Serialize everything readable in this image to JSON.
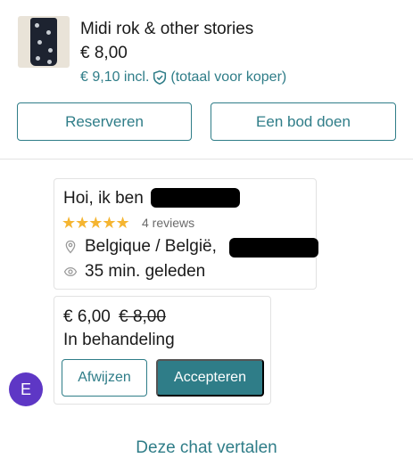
{
  "item": {
    "title": "Midi rok & other stories",
    "price": "€ 8,00",
    "buyer_total": "€ 9,10 incl.",
    "buyer_total_note": "(totaal voor koper)"
  },
  "actions": {
    "reserve_label": "Reserveren",
    "offer_label": "Een bod doen"
  },
  "profile": {
    "greeting": "Hoi, ik ben",
    "stars": "★★★★★",
    "reviews": "4 reviews",
    "location": "Belgique / België,",
    "last_seen": "35 min. geleden"
  },
  "offer": {
    "new_price": "€ 6,00",
    "old_price": "€ 8,00",
    "status": "In behandeling",
    "decline_label": "Afwijzen",
    "accept_label": "Accepteren"
  },
  "avatar": {
    "initial": "E"
  },
  "footer": {
    "translate_label": "Deze chat vertalen"
  },
  "colors": {
    "accent": "#2f7d88",
    "star": "#f5b531",
    "avatar_bg": "#5e37c5"
  }
}
